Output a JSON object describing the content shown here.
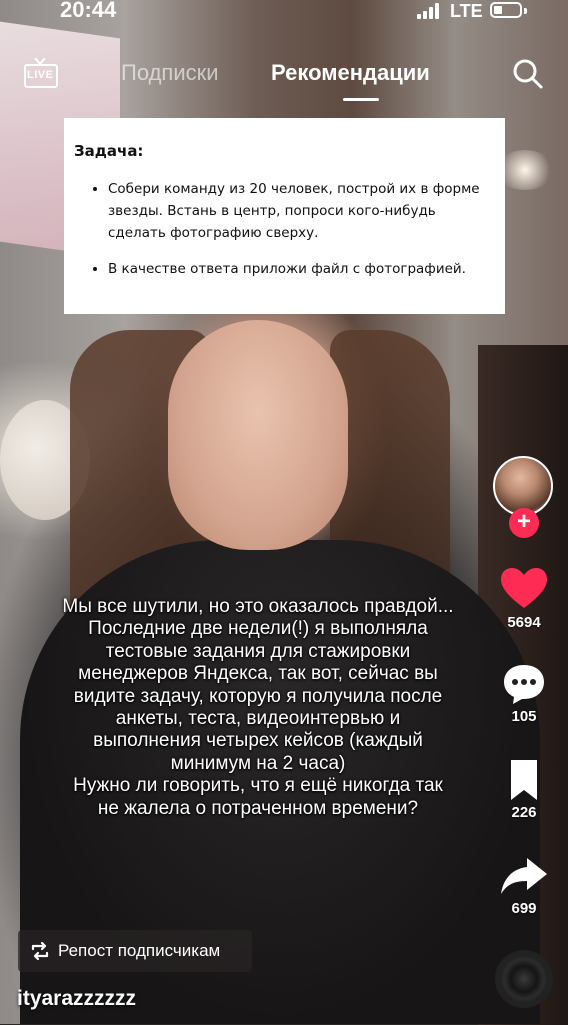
{
  "status_bar": {
    "time": "20:44",
    "network": "LTE"
  },
  "nav": {
    "live_label": "LIVE",
    "tab_following": "Подписки",
    "tab_for_you": "Рекомендации",
    "search_icon": "search-icon"
  },
  "task_card": {
    "title": "Задача:",
    "items": [
      "Собери команду из 20 человек, построй их в форме звезды. Встань в центр, попроси кого-нибудь сделать фотографию сверху.",
      "В качестве ответа приложи файл с фотографией."
    ]
  },
  "caption": "Мы все шутили, но это оказалось правдой...\nПоследние две недели(!) я выполняла\nтестовые задания для стажировки\nменеджеров Яндекса, так вот, сейчас вы\nвидите задачу, которую я получила после\nанкеты, теста, видеоинтервью и\nвыполнения четырех кейсов (каждый\nминимум на 2 часа)\nНужно ли говорить, что я ещё никогда так\nне жалела о потраченном времени?",
  "rail": {
    "follow_symbol": "+",
    "likes": "5694",
    "comments": "105",
    "favorites": "226",
    "shares": "699"
  },
  "repost": {
    "label": "Репост подписчикам"
  },
  "author": {
    "username": "ityarazzzzzz"
  },
  "colors": {
    "like": "#fe2c55",
    "follow": "#fe2c55",
    "text": "#ffffff"
  }
}
